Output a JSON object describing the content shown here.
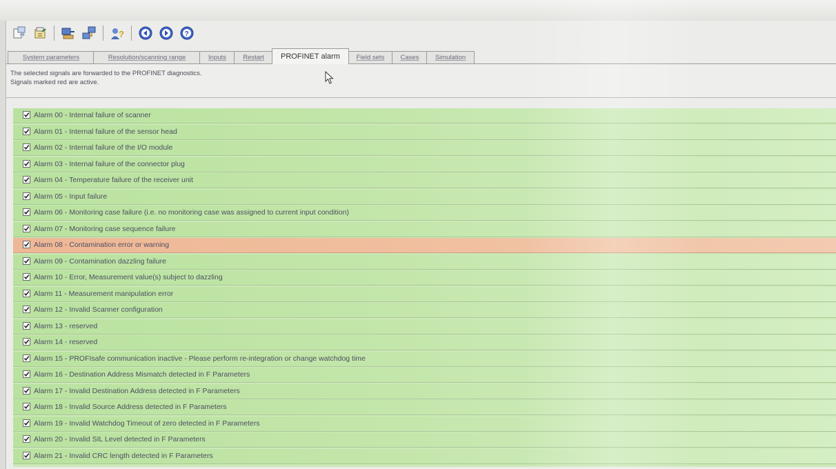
{
  "tabs": [
    {
      "label": "System parameters",
      "active": false
    },
    {
      "label": "Resolution/scanning range",
      "active": false
    },
    {
      "label": "Inputs",
      "active": false
    },
    {
      "label": "Restart",
      "active": false
    },
    {
      "label": "PROFINET alarm",
      "active": true
    },
    {
      "label": "Field sets",
      "active": false
    },
    {
      "label": "Cases",
      "active": false
    },
    {
      "label": "Simulation",
      "active": false
    }
  ],
  "info": {
    "line1": "The selected signals are forwarded to the PROFINET diagnostics.",
    "line2": "Signals marked red are active."
  },
  "toolbar": {
    "icons": [
      "import-icon",
      "export-icon",
      "connect-icon",
      "network-icon",
      "user-help-icon",
      "previous-icon",
      "next-icon",
      "help-icon"
    ]
  },
  "colors": {
    "inactive_row": "#bfe3a5",
    "active_row": "#efbc9c"
  },
  "alarms": [
    {
      "label": "Alarm 00 - Internal failure of scanner",
      "checked": true,
      "active": false
    },
    {
      "label": "Alarm 01 - Internal failure of the sensor head",
      "checked": true,
      "active": false
    },
    {
      "label": "Alarm 02 - Internal failure of the I/O module",
      "checked": true,
      "active": false
    },
    {
      "label": "Alarm 03 - Internal failure of the connector plug",
      "checked": true,
      "active": false
    },
    {
      "label": "Alarm 04 - Temperature failure of the receiver unit",
      "checked": true,
      "active": false
    },
    {
      "label": "Alarm 05 - Input failure",
      "checked": true,
      "active": false
    },
    {
      "label": "Alarm 06 - Monitoring case failure (i.e. no monitoring case was assigned to current input condition)",
      "checked": true,
      "active": false
    },
    {
      "label": "Alarm 07 - Monitoring case sequence failure",
      "checked": true,
      "active": false
    },
    {
      "label": "Alarm 08 - Contamination error or warning",
      "checked": true,
      "active": true
    },
    {
      "label": "Alarm 09 - Contamination dazzling failure",
      "checked": true,
      "active": false
    },
    {
      "label": "Alarm 10 - Error, Measurement value(s) subject to dazzling",
      "checked": true,
      "active": false
    },
    {
      "label": "Alarm 11 - Measurement manipulation error",
      "checked": true,
      "active": false
    },
    {
      "label": "Alarm 12 - Invalid Scanner configuration",
      "checked": true,
      "active": false
    },
    {
      "label": "Alarm 13 - reserved",
      "checked": true,
      "active": false
    },
    {
      "label": "Alarm 14 - reserved",
      "checked": true,
      "active": false
    },
    {
      "label": "Alarm 15 - PROFIsafe communication inactive - Please perform re-integration or change watchdog time",
      "checked": true,
      "active": false
    },
    {
      "label": "Alarm 16 - Destination Address Mismatch detected in F Parameters",
      "checked": true,
      "active": false
    },
    {
      "label": "Alarm 17 - Invalid Destination Address detected in F Parameters",
      "checked": true,
      "active": false
    },
    {
      "label": "Alarm 18 - Invalid Source Address detected in F Parameters",
      "checked": true,
      "active": false
    },
    {
      "label": "Alarm 19 - Invalid Watchdog Timeout of zero detected in F Parameters",
      "checked": true,
      "active": false
    },
    {
      "label": "Alarm 20 - Invalid SIL Level detected in F Parameters",
      "checked": true,
      "active": false
    },
    {
      "label": "Alarm 21 - Invalid CRC length detected in F Parameters",
      "checked": true,
      "active": false
    }
  ]
}
